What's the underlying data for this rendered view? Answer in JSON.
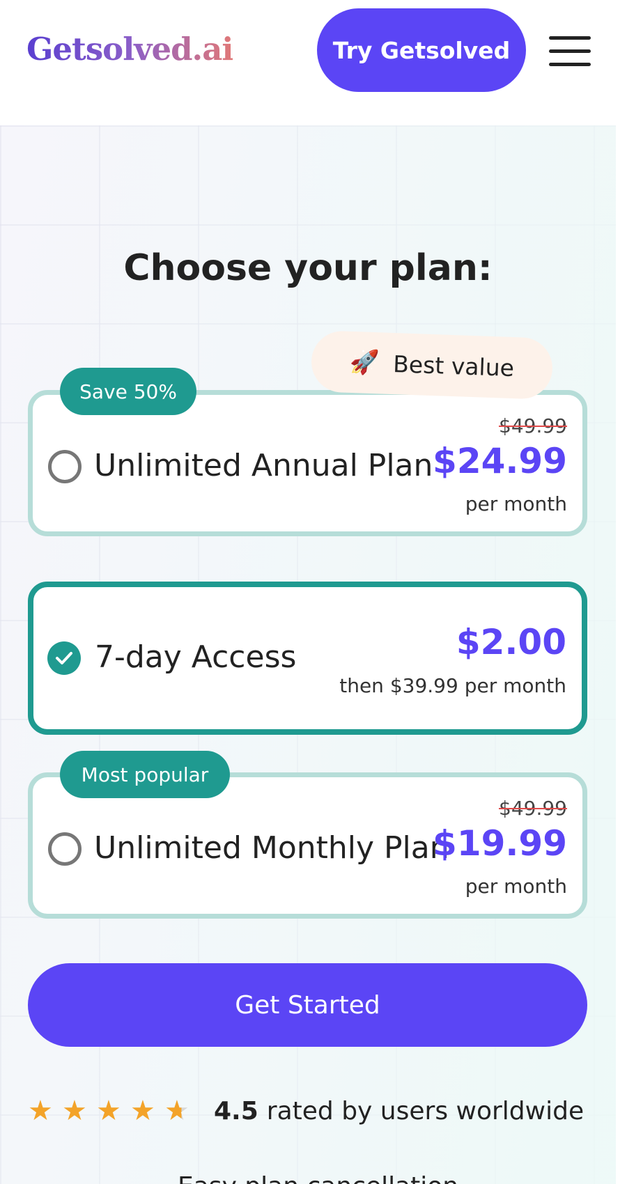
{
  "header": {
    "logo": "Getsolved.ai",
    "try_button": "Try Getsolved",
    "menu_icon": "hamburger-menu-icon"
  },
  "main": {
    "title": "Choose your plan:",
    "best_value_badge": {
      "icon": "rocket-icon",
      "label": "Best value"
    },
    "plans": [
      {
        "badge": "Save 50%",
        "name": "Unlimited Annual Plan",
        "old_price": "$49.99",
        "price": "$24.99",
        "period": "per month",
        "selected": false
      },
      {
        "name": "7-day Access",
        "price": "$2.00",
        "period": "then $39.99 per month",
        "selected": true
      },
      {
        "badge": "Most popular",
        "name": "Unlimited Monthly Plan",
        "old_price": "$49.99",
        "price": "$19.99",
        "period": "per month",
        "selected": false
      }
    ],
    "cta_button": "Get Started",
    "rating": {
      "stars": 4.5,
      "value": "4.5",
      "text": "rated by users worldwide"
    },
    "cutoff_text": "Easy plan cancellation"
  },
  "colors": {
    "brand_purple": "#5b45f5",
    "teal": "#1f9a90",
    "star": "#f3a329"
  }
}
